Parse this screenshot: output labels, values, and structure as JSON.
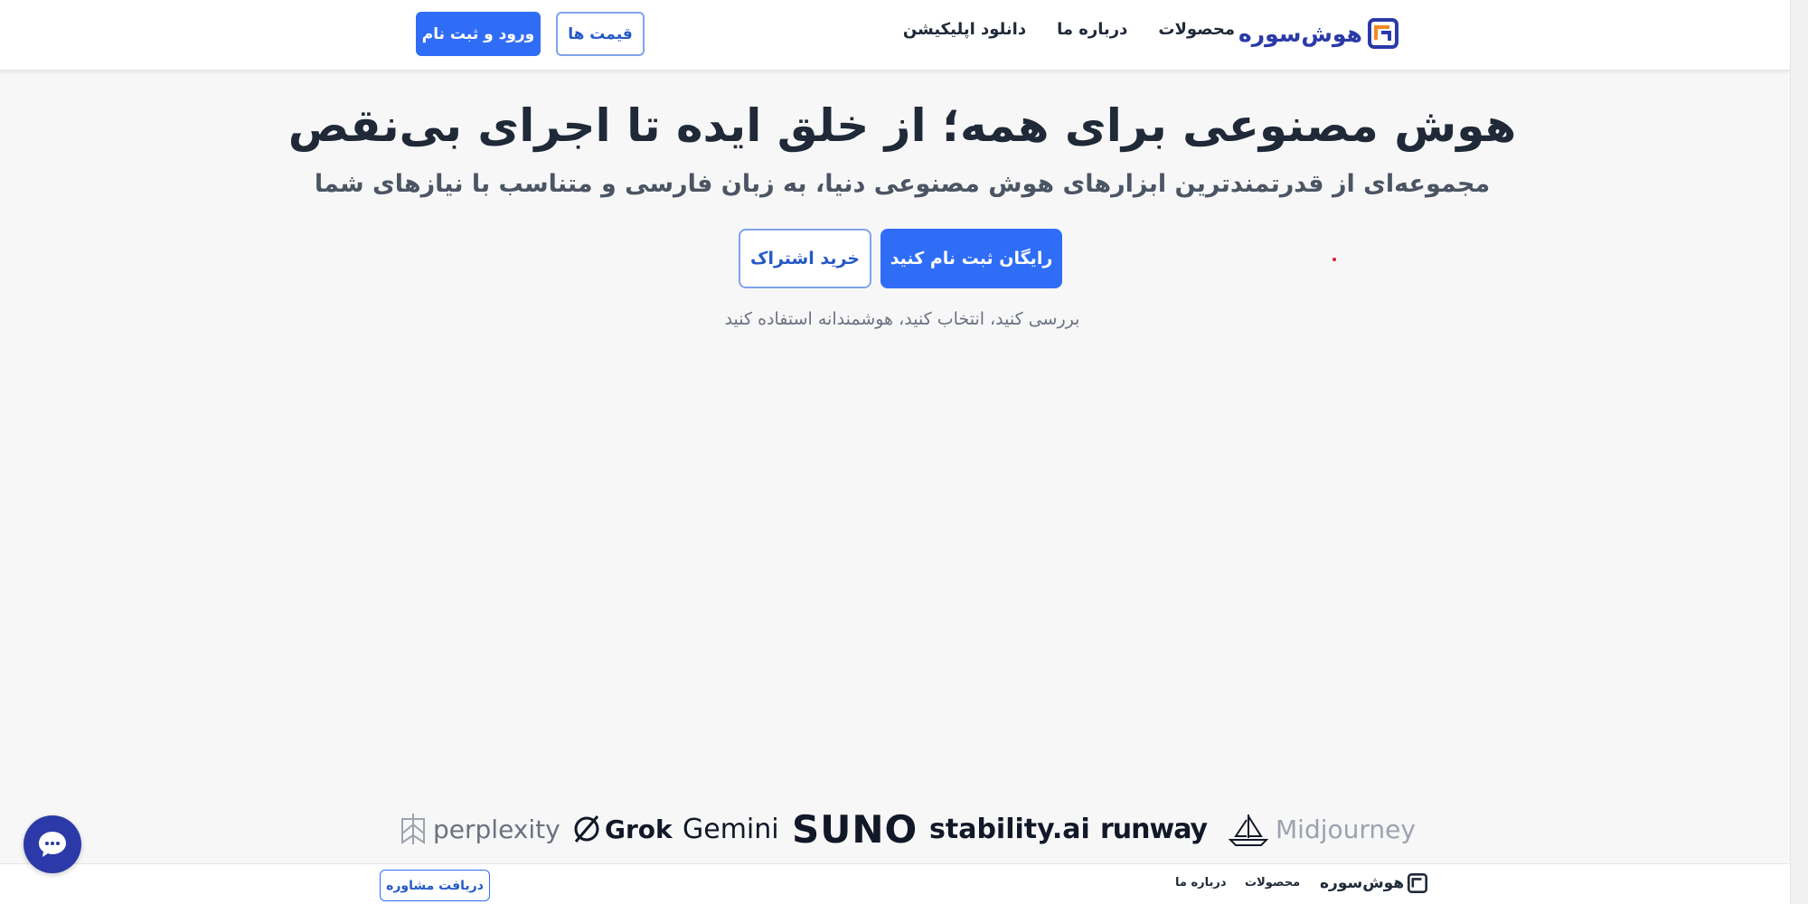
{
  "header": {
    "logo_text": "هوش‌سوره",
    "nav": [
      "محصولات",
      "درباره ما",
      "دانلود اپلیکیشن"
    ],
    "pricing_label": "قیمت ها",
    "login_label": "ورود و ثبت نام"
  },
  "hero": {
    "title": "هوش مصنوعی برای همه؛ از خلق ایده تا اجرای بی‌نقص",
    "subtitle": "مجموعه‌ای از قدرتمندترین ابزارهای هوش مصنوعی دنیا، به زبان فارسی و متناسب با نیازهای شما",
    "signup_label": "رایگان ثبت نام کنید",
    "subscribe_label": "خرید اشتراک",
    "note": "بررسی کنید، انتخاب کنید، هوشمندانه استفاده کنید"
  },
  "brands": [
    "perplexity",
    "Grok",
    "Gemini",
    "SUNO",
    "stability.ai",
    "runway",
    "Midjourney"
  ],
  "footer": {
    "logo_text": "هوش‌سوره",
    "nav": [
      "محصولات",
      "درباره ما"
    ],
    "consult_label": "دریافت مشاوره"
  },
  "colors": {
    "primary": "#2f6df6",
    "brand_blue": "#2b3aa8",
    "brand_orange": "#f08a24"
  }
}
